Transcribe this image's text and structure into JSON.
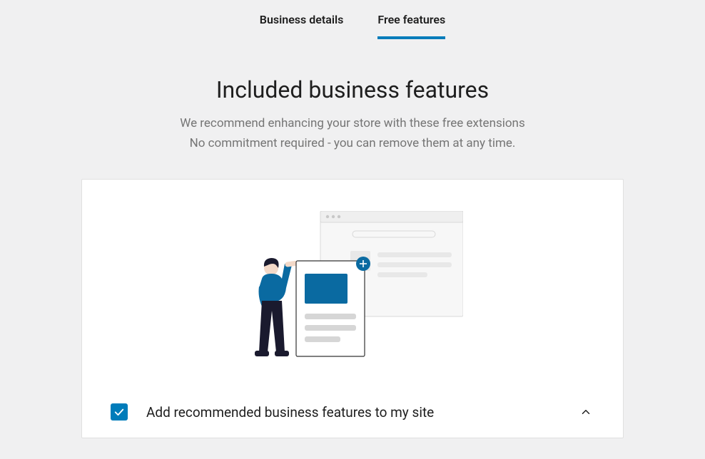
{
  "tabs": {
    "business_details": "Business details",
    "free_features": "Free features"
  },
  "header": {
    "title": "Included business features",
    "subtitle_line1": "We recommend enhancing your store with these free extensions",
    "subtitle_line2": "No commitment required - you can remove them at any time."
  },
  "accordion": {
    "checkbox_checked": true,
    "label": "Add recommended business features to my site"
  },
  "colors": {
    "accent": "#007cba",
    "text_primary": "#1e1e1e",
    "text_secondary": "#757575",
    "background": "#f0f0f1",
    "card_bg": "#ffffff"
  }
}
